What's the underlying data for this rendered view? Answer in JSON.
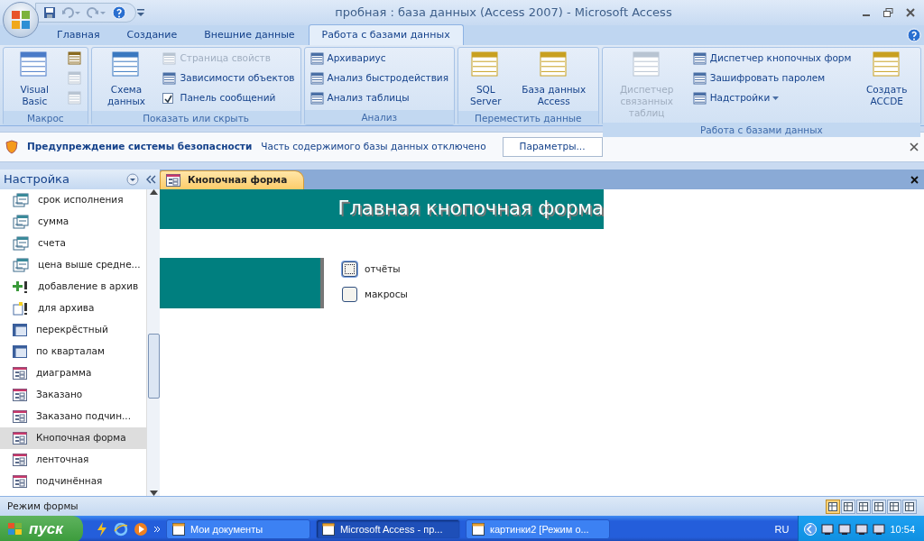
{
  "window": {
    "title": "пробная : база данных (Access 2007) - Microsoft Access"
  },
  "ribbon_tabs": [
    {
      "label": "Главная",
      "selected": false
    },
    {
      "label": "Создание",
      "selected": false
    },
    {
      "label": "Внешние данные",
      "selected": false
    },
    {
      "label": "Работа с базами данных",
      "selected": true
    }
  ],
  "ribbon_groups": [
    {
      "label": "Макрос",
      "columns": [
        {
          "kind": "large",
          "label": "Visual Basic",
          "disabled": false
        },
        {
          "kind": "stack",
          "items": [
            {
              "kind": "icon",
              "disabled": false
            },
            {
              "kind": "icon",
              "disabled": true
            },
            {
              "kind": "icon",
              "disabled": true
            }
          ]
        }
      ]
    },
    {
      "label": "Показать или скрыть",
      "columns": [
        {
          "kind": "large",
          "label": "Схема данных",
          "disabled": false
        },
        {
          "kind": "stack",
          "items": [
            {
              "kind": "button",
              "label": "Страница свойств",
              "disabled": true
            },
            {
              "kind": "button",
              "label": "Зависимости объектов",
              "disabled": false
            },
            {
              "kind": "check",
              "label": "Панель сообщений",
              "checked": true,
              "disabled": false
            }
          ]
        }
      ]
    },
    {
      "label": "Анализ",
      "columns": [
        {
          "kind": "stack",
          "items": [
            {
              "kind": "button",
              "label": "Архивариус",
              "disabled": false
            },
            {
              "kind": "button",
              "label": "Анализ быстродействия",
              "disabled": false
            },
            {
              "kind": "button",
              "label": "Анализ таблицы",
              "disabled": false
            }
          ]
        }
      ]
    },
    {
      "label": "Переместить данные",
      "columns": [
        {
          "kind": "large",
          "label": "SQL Server",
          "disabled": false
        },
        {
          "kind": "large",
          "label": "База данных Access",
          "disabled": false
        }
      ]
    },
    {
      "label": "Работа с базами данных",
      "columns": [
        {
          "kind": "large",
          "label": "Диспетчер связанных таблиц",
          "disabled": true
        },
        {
          "kind": "stack",
          "items": [
            {
              "kind": "button",
              "label": "Диспетчер кнопочных форм",
              "disabled": false
            },
            {
              "kind": "button",
              "label": "Зашифровать паролем",
              "disabled": false
            },
            {
              "kind": "menu",
              "label": "Надстройки",
              "disabled": false
            }
          ]
        },
        {
          "kind": "large",
          "label": "Создать ACCDE",
          "disabled": false
        }
      ]
    }
  ],
  "security_bar": {
    "title": "Предупреждение системы безопасности",
    "message": "Часть содержимого базы данных отключено",
    "button": "Параметры..."
  },
  "navigation_pane": {
    "title": "Настройка",
    "items": [
      {
        "label": "срок исполнения",
        "kind": "query",
        "selected": false
      },
      {
        "label": "сумма",
        "kind": "query",
        "selected": false
      },
      {
        "label": "счета",
        "kind": "query",
        "selected": false
      },
      {
        "label": "цена выше средне...",
        "kind": "query",
        "selected": false
      },
      {
        "label": "добавление в архив",
        "kind": "append",
        "selected": false
      },
      {
        "label": "для архива",
        "kind": "maketable",
        "selected": false
      },
      {
        "label": "перекрёстный",
        "kind": "crosstab",
        "selected": false
      },
      {
        "label": "по кварталам",
        "kind": "crosstab",
        "selected": false
      },
      {
        "label": "диаграмма",
        "kind": "form",
        "selected": false
      },
      {
        "label": "Заказано",
        "kind": "form",
        "selected": false
      },
      {
        "label": "Заказано подчин...",
        "kind": "form",
        "selected": false
      },
      {
        "label": "Кнопочная форма",
        "kind": "form",
        "selected": true
      },
      {
        "label": "ленточная",
        "kind": "form",
        "selected": false
      },
      {
        "label": "подчинённая",
        "kind": "form",
        "selected": false
      }
    ]
  },
  "document_tab": {
    "label": "Кнопочная форма"
  },
  "form": {
    "title": "Главная кнопочная форма",
    "buttons": [
      {
        "label": "отчёты",
        "focused": true
      },
      {
        "label": "макросы",
        "focused": false
      }
    ]
  },
  "status_bar": {
    "text": "Режим формы",
    "views": [
      {
        "selected": true
      },
      {
        "selected": false
      },
      {
        "selected": false
      },
      {
        "selected": false
      },
      {
        "selected": false
      },
      {
        "selected": false
      }
    ]
  },
  "taskbar": {
    "start": "пуск",
    "tasks": [
      {
        "label": "Мои документы",
        "selected": false
      },
      {
        "label": "Microsoft Access - пр...",
        "selected": true
      },
      {
        "label": "картинки2 [Режим о...",
        "selected": false
      }
    ],
    "language": "RU",
    "clock": "10:54"
  }
}
